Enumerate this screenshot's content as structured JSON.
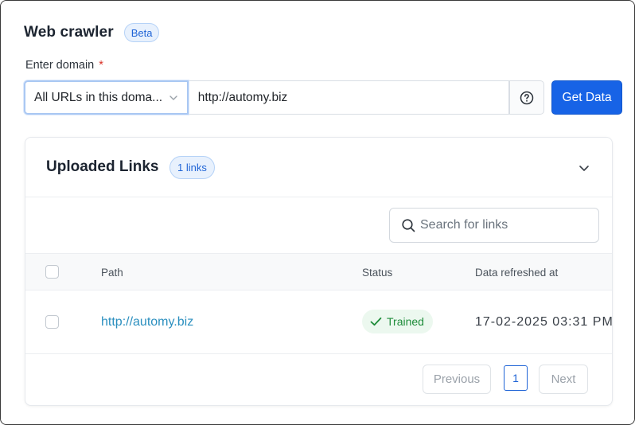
{
  "header": {
    "title": "Web crawler",
    "badge": "Beta"
  },
  "domain_form": {
    "label": "Enter domain",
    "required_mark": "*",
    "scope_select_value": "All URLs in this doma...",
    "url_value": "http://automy.biz",
    "submit_label": "Get Data"
  },
  "uploaded_links": {
    "title": "Uploaded Links",
    "count_badge": "1 links",
    "search_placeholder": "Search for links",
    "columns": {
      "path": "Path",
      "status": "Status",
      "refreshed": "Data refreshed at"
    },
    "rows": [
      {
        "path": "http://automy.biz",
        "status": "Trained",
        "refreshed": "17-02-2025 03:31 PM"
      }
    ],
    "pagination": {
      "previous": "Previous",
      "current_page": "1",
      "next": "Next"
    }
  },
  "colors": {
    "primary": "#1763e6",
    "badge_bg": "#e8f1fd",
    "badge_text": "#1f64d6",
    "link": "#2b8fbf",
    "success_bg": "#ecf8ef",
    "success_text": "#1e8c3a",
    "required": "#d93025"
  },
  "icons": {
    "scope_chevron": "chevron-down-icon",
    "help": "question-circle-icon",
    "collapse": "chevron-down-icon",
    "search": "search-icon",
    "status": "check-icon"
  }
}
